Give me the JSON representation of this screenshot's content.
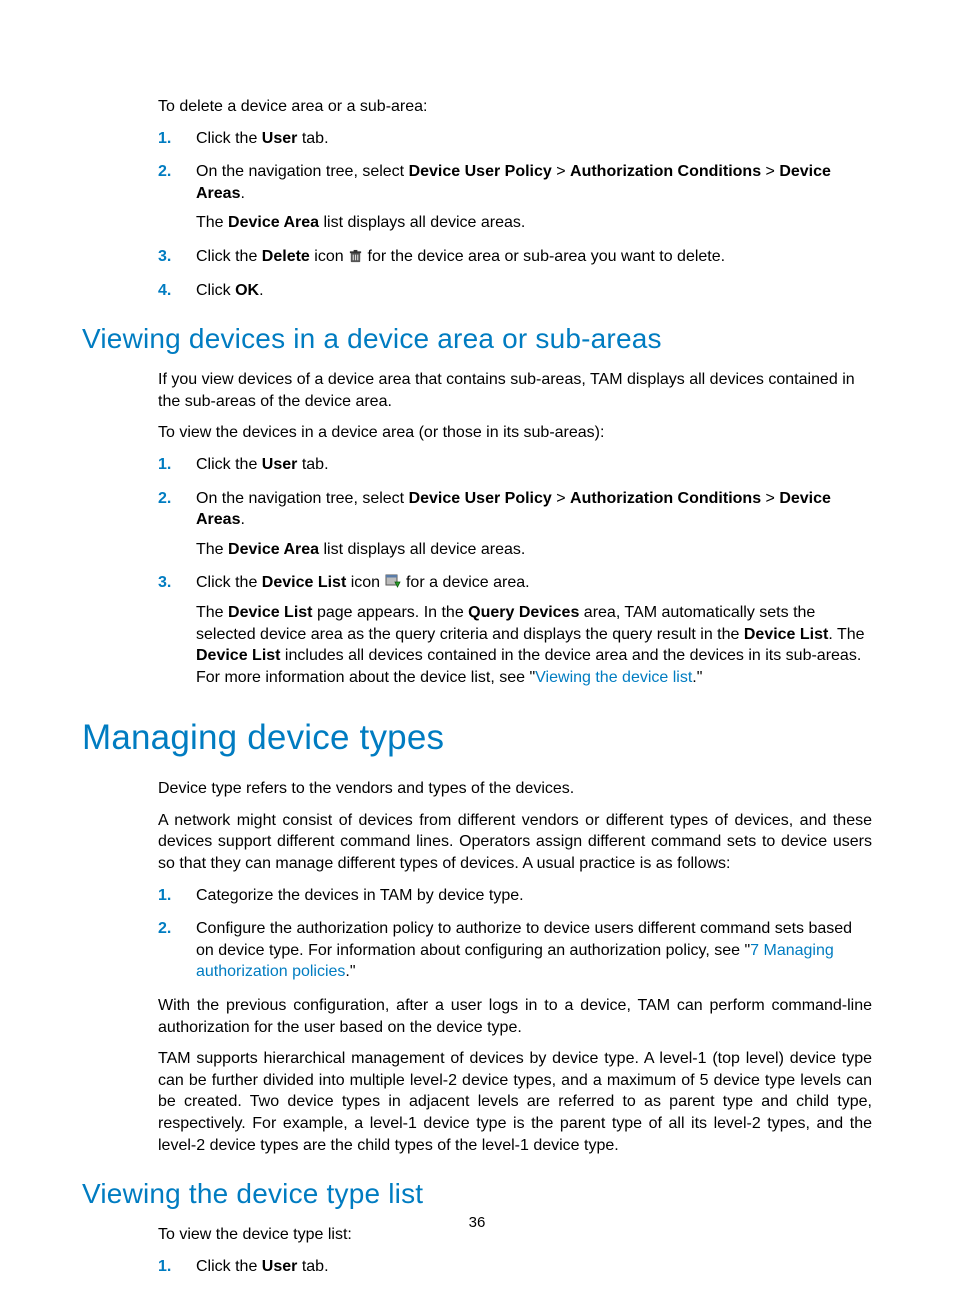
{
  "section1": {
    "intro": "To delete a device area or a sub-area:",
    "items": [
      {
        "n": "1.",
        "p1a": "Click the ",
        "p1b": "User",
        "p1c": " tab."
      },
      {
        "n": "2.",
        "p1a": "On the navigation tree, select ",
        "p1b": "Device User Policy",
        "p1c": " > ",
        "p1d": "Authorization Conditions",
        "p1e": " > ",
        "p1f": "Device Areas",
        "p1g": ".",
        "p2a": "The ",
        "p2b": "Device Area",
        "p2c": " list displays all device areas."
      },
      {
        "n": "3.",
        "p1a": "Click the ",
        "p1b": "Delete",
        "p1c": " icon ",
        "p1d": " for the device area or sub-area you want to delete."
      },
      {
        "n": "4.",
        "p1a": "Click ",
        "p1b": "OK",
        "p1c": "."
      }
    ]
  },
  "section2": {
    "heading": "Viewing devices in a device area or sub-areas",
    "p1": "If you view devices of a device area that contains sub-areas, TAM displays all devices contained in the sub-areas of the device area.",
    "p2": "To view the devices in a device area (or those in its sub-areas):",
    "items": [
      {
        "n": "1.",
        "p1a": "Click the ",
        "p1b": "User",
        "p1c": " tab."
      },
      {
        "n": "2.",
        "p1a": "On the navigation tree, select ",
        "p1b": "Device User Policy",
        "p1c": " > ",
        "p1d": "Authorization Conditions",
        "p1e": " > ",
        "p1f": "Device Areas",
        "p1g": ".",
        "p2a": "The ",
        "p2b": "Device Area",
        "p2c": " list displays all device areas."
      },
      {
        "n": "3.",
        "p1a": "Click the ",
        "p1b": "Device List",
        "p1c": " icon ",
        "p1d": " for a device area.",
        "p2a": "The ",
        "p2b": "Device List",
        "p2c": " page appears. In the ",
        "p2d": "Query Devices",
        "p2e": " area, TAM automatically sets the selected device area as the query criteria and displays the query result in the ",
        "p2f": "Device List",
        "p2g": ". The ",
        "p2h": "Device List",
        "p2i": " includes all devices contained in the device area and the devices in its sub-areas. For more information about the device list, see \"",
        "p2link": "Viewing the device list",
        "p2j": ".\""
      }
    ]
  },
  "section3": {
    "heading": "Managing device types",
    "p1": "Device type refers to the vendors and types of the devices.",
    "p2": "A network might consist of devices from different vendors or different types of devices, and these devices support different command lines. Operators assign different command sets to device users so that they can manage different types of devices. A usual practice is as follows:",
    "items": [
      {
        "n": "1.",
        "p1": "Categorize the devices in TAM by device type."
      },
      {
        "n": "2.",
        "p1a": "Configure the authorization policy to authorize to device users different command sets based on device type. For information about configuring an authorization policy, see \"",
        "p1link": "7 Managing authorization policies",
        "p1b": ".\""
      }
    ],
    "p3": "With the previous configuration, after a user logs in to a device, TAM can perform command-line authorization for the user based on the device type.",
    "p4": "TAM supports hierarchical management of devices by device type. A level-1 (top level) device type can be further divided into multiple level-2 device types, and a maximum of 5 device type levels can be created. Two device types in adjacent levels are referred to as parent type and child type, respectively. For example, a level-1 device type is the parent type of all its level-2 types, and the level-2 device types are the child types of the level-1 device type."
  },
  "section4": {
    "heading": "Viewing the device type list",
    "p1": "To view the device type list:",
    "items": [
      {
        "n": "1.",
        "p1a": "Click the ",
        "p1b": "User",
        "p1c": " tab."
      }
    ]
  },
  "pagenum": "36"
}
